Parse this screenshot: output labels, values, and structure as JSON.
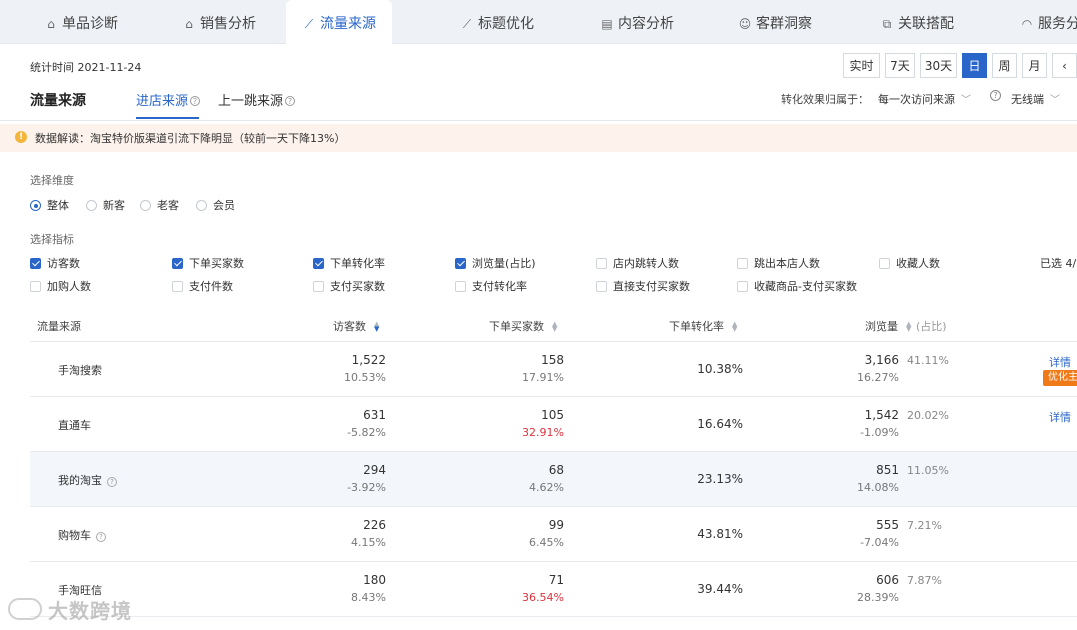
{
  "tabs": [
    {
      "label": "单品诊断",
      "icon": "box-icon",
      "glyph": "⌂"
    },
    {
      "label": "销售分析",
      "icon": "bag-icon",
      "glyph": "⌂"
    },
    {
      "label": "流量来源",
      "icon": "trend-chart-icon",
      "glyph": "⟋"
    },
    {
      "label": "标题优化",
      "icon": "line-chart-icon",
      "glyph": "⟋"
    },
    {
      "label": "内容分析",
      "icon": "document-icon",
      "glyph": "▤"
    },
    {
      "label": "客群洞察",
      "icon": "users-icon",
      "glyph": "☺"
    },
    {
      "label": "关联搭配",
      "icon": "link-icon",
      "glyph": "⧉"
    },
    {
      "label": "服务分",
      "icon": "headset-icon",
      "glyph": "◠"
    }
  ],
  "active_tab": 2,
  "stat_time": "统计时间 2021-11-24",
  "time_ranges": [
    "实时",
    "7天",
    "30天",
    "日",
    "周",
    "月"
  ],
  "active_range": 3,
  "prev_arrow": "‹",
  "section_title": "流量来源",
  "subtabs": [
    "进店来源",
    "上一跳来源"
  ],
  "attribution": {
    "label": "转化效果归属于：",
    "value": "每一次访问来源",
    "device_value": "无线端"
  },
  "notice": "数据解读：淘宝特价版渠道引流下降明显（较前一天下降13%）",
  "dimension": {
    "label": "选择维度",
    "options": [
      "整体",
      "新客",
      "老客",
      "会员"
    ],
    "selected": 0
  },
  "metrics": {
    "label": "选择指标",
    "selected_text": "已选 4/",
    "row1": [
      {
        "label": "访客数",
        "checked": true
      },
      {
        "label": "下单买家数",
        "checked": true
      },
      {
        "label": "下单转化率",
        "checked": true
      },
      {
        "label": "浏览量(占比)",
        "checked": true
      },
      {
        "label": "店内跳转人数",
        "checked": false
      },
      {
        "label": "跳出本店人数",
        "checked": false
      },
      {
        "label": "收藏人数",
        "checked": false
      }
    ],
    "row2": [
      {
        "label": "加购人数",
        "checked": false
      },
      {
        "label": "支付件数",
        "checked": false
      },
      {
        "label": "支付买家数",
        "checked": false
      },
      {
        "label": "支付转化率",
        "checked": false
      },
      {
        "label": "直接支付买家数",
        "checked": false
      },
      {
        "label": "收藏商品-支付买家数",
        "checked": false
      }
    ]
  },
  "table": {
    "headers": [
      "流量来源",
      "访客数",
      "下单买家数",
      "下单转化率",
      "浏览量",
      "(占比)"
    ],
    "detail_label": "详情",
    "badge_label": "优化主",
    "rows": [
      {
        "name": "手淘搜索",
        "help": false,
        "visitors": "1,522",
        "visitors_pct": "10.53%",
        "buyers": "158",
        "buyers_pct": "17.91%",
        "buyers_red": false,
        "conv": "10.38%",
        "pv": "3,166",
        "pv_pct": "16.27%",
        "share": "41.11%",
        "detail": true,
        "badge": true
      },
      {
        "name": "直通车",
        "help": false,
        "visitors": "631",
        "visitors_pct": "-5.82%",
        "buyers": "105",
        "buyers_pct": "32.91%",
        "buyers_red": true,
        "conv": "16.64%",
        "pv": "1,542",
        "pv_pct": "-1.09%",
        "share": "20.02%",
        "detail": true,
        "badge": false
      },
      {
        "name": "我的淘宝",
        "help": true,
        "visitors": "294",
        "visitors_pct": "-3.92%",
        "buyers": "68",
        "buyers_pct": "4.62%",
        "buyers_red": false,
        "conv": "23.13%",
        "pv": "851",
        "pv_pct": "14.08%",
        "share": "11.05%",
        "detail": false,
        "badge": false
      },
      {
        "name": "购物车",
        "help": true,
        "visitors": "226",
        "visitors_pct": "4.15%",
        "buyers": "99",
        "buyers_pct": "6.45%",
        "buyers_red": false,
        "conv": "43.81%",
        "pv": "555",
        "pv_pct": "-7.04%",
        "share": "7.21%",
        "detail": false,
        "badge": false
      },
      {
        "name": "手淘旺信",
        "help": false,
        "visitors": "180",
        "visitors_pct": "8.43%",
        "buyers": "71",
        "buyers_pct": "36.54%",
        "buyers_red": true,
        "conv": "39.44%",
        "pv": "606",
        "pv_pct": "28.39%",
        "share": "7.87%",
        "detail": false,
        "badge": false
      }
    ]
  },
  "watermark": "大数跨境"
}
